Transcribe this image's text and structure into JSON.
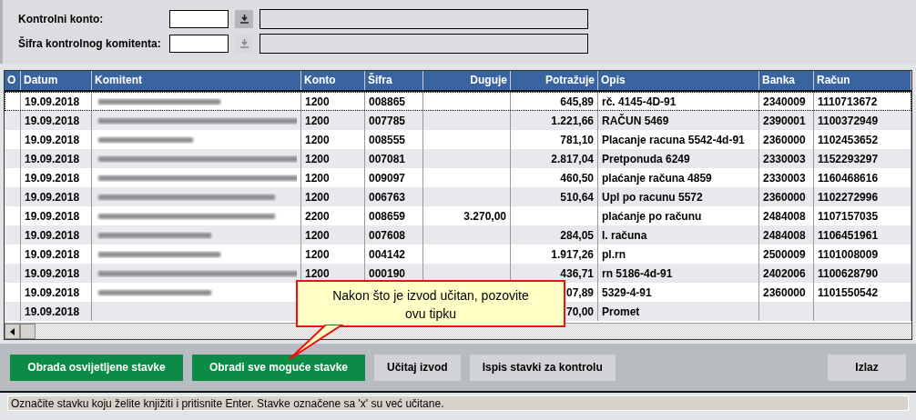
{
  "filters": [
    {
      "label": "Kontrolni konto:",
      "button_enabled": true
    },
    {
      "label": "Šifra kontrolnog komitenta:",
      "button_enabled": false
    }
  ],
  "table": {
    "columns": [
      "O",
      "Datum",
      "Komitent",
      "Konto",
      "Šifra",
      "Duguje",
      "Potražuje",
      "Opis",
      "Banka",
      "Račun"
    ],
    "rows": [
      {
        "selected": true,
        "komitent_redacted": true,
        "cells": [
          "",
          "19.09.2018",
          "",
          "1200",
          "008865",
          "",
          "645,89",
          "rč. 4145-4D-91",
          "2340009",
          "1110713672"
        ]
      },
      {
        "selected": false,
        "komitent_redacted": true,
        "cells": [
          "",
          "19.09.2018",
          "",
          "1200",
          "007785",
          "",
          "1.221,66",
          "RAČUN 5469",
          "2390001",
          "1100372949"
        ]
      },
      {
        "selected": false,
        "komitent_redacted": true,
        "cells": [
          "",
          "19.09.2018",
          "",
          "1200",
          "008555",
          "",
          "781,10",
          "Placanje racuna 5542-4d-91",
          "2360000",
          "1102453652"
        ]
      },
      {
        "selected": false,
        "komitent_redacted": true,
        "cells": [
          "",
          "19.09.2018",
          "",
          "1200",
          "007081",
          "",
          "2.817,04",
          "Pretponuda 6249",
          "2330003",
          "1152293297"
        ]
      },
      {
        "selected": false,
        "komitent_redacted": true,
        "cells": [
          "",
          "19.09.2018",
          "",
          "1200",
          "009097",
          "",
          "460,50",
          "plaćanje računa 4859",
          "2330003",
          "1160468616"
        ]
      },
      {
        "selected": false,
        "komitent_redacted": true,
        "cells": [
          "",
          "19.09.2018",
          "",
          "1200",
          "006763",
          "",
          "510,64",
          "Upl po racunu 5572",
          "2360000",
          "1102272996"
        ]
      },
      {
        "selected": false,
        "komitent_redacted": true,
        "cells": [
          "",
          "19.09.2018",
          "",
          "2200",
          "008659",
          "3.270,00",
          "",
          "plaćanje po računu",
          "2484008",
          "1107157035"
        ]
      },
      {
        "selected": false,
        "komitent_redacted": true,
        "cells": [
          "",
          "19.09.2018",
          "",
          "1200",
          "007608",
          "",
          "284,05",
          "I. računa",
          "2484008",
          "1106451961"
        ]
      },
      {
        "selected": false,
        "komitent_redacted": true,
        "cells": [
          "",
          "19.09.2018",
          "",
          "1200",
          "004142",
          "",
          "1.917,26",
          "pl.rn",
          "2500009",
          "1101008009"
        ]
      },
      {
        "selected": false,
        "komitent_redacted": true,
        "cells": [
          "",
          "19.09.2018",
          "",
          "1200",
          "000190",
          "",
          "436,71",
          "rn 5186-4d-91",
          "2402006",
          "1100628790"
        ]
      },
      {
        "selected": false,
        "komitent_redacted": true,
        "cells": [
          "",
          "19.09.2018",
          "",
          "",
          "",
          "",
          "07,89",
          "5329-4-91",
          "2360000",
          "1101550542"
        ]
      },
      {
        "selected": false,
        "komitent_redacted": false,
        "cells": [
          "",
          "19.09.2018",
          "",
          "",
          "",
          "",
          "70,00",
          "Promet",
          "",
          ""
        ]
      }
    ]
  },
  "callout": "Nakon što je izvod učitan, pozovite ovu tipku",
  "buttons": [
    {
      "label": "Obrada osvijetljene stavke",
      "kind": "primary"
    },
    {
      "label": "Obradi sve moguće stavke",
      "kind": "primary"
    },
    {
      "label": "Učitaj izvod",
      "kind": "secondary"
    },
    {
      "label": "Ispis stavki za kontrolu",
      "kind": "secondary"
    },
    {
      "label": "Izlaz",
      "kind": "exit"
    }
  ],
  "status_bar": "Označite stavku koju želite knjižiti i pritisnite Enter. Stavke označene sa 'x' su već učitane."
}
